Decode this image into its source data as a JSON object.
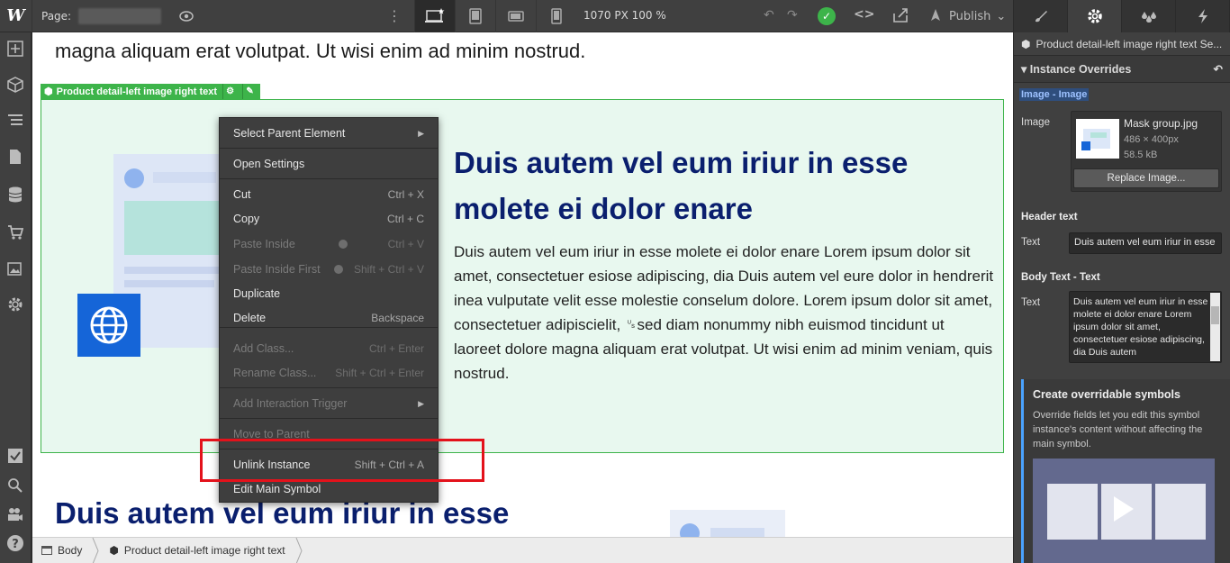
{
  "topbar": {
    "logo": "W",
    "page_label": "Page:",
    "dimensions": "1070 PX  100 %",
    "publish_label": "Publish"
  },
  "canvas": {
    "top_text": "magna aliquam erat volutpat. Ut wisi enim ad minim nostrud.",
    "symbol_tag": "Product detail-left image right text",
    "hero_heading": "Duis autem vel eum iriur in esse molete ei dolor enare",
    "hero_body": "Duis autem vel eum iriur in esse molete ei dolor enare Lorem ipsum dolor sit amet, consectetuer esiose adipiscing,  dia Duis autem vel eure dolor in hendrerit inea vulputate velit esse molestie conselum dolore. Lorem ipsum dolor sit amet, consectetuer adipiscielit, ␟sed diam nonummy nibh euismod tincidunt ut laoreet dolore magna aliquam erat volutpat. Ut wisi enim ad minim veniam, quis nostrud.",
    "bottom_heading": "Duis autem vel eum iriur in esse"
  },
  "context_menu": {
    "items": [
      {
        "label": "Select Parent Element",
        "shortcut": "",
        "submenu": true,
        "disabled": false
      },
      {
        "label": "Open Settings",
        "shortcut": "",
        "disabled": false
      },
      {
        "label": "Cut",
        "shortcut": "Ctrl + X",
        "disabled": false
      },
      {
        "label": "Copy",
        "shortcut": "Ctrl + C",
        "disabled": false
      },
      {
        "label": "Paste Inside",
        "shortcut": "Ctrl + V",
        "disabled": true
      },
      {
        "label": "Paste Inside First",
        "shortcut": "Shift + Ctrl + V",
        "disabled": true
      },
      {
        "label": "Duplicate",
        "shortcut": "",
        "disabled": false
      },
      {
        "label": "Delete",
        "shortcut": "Backspace",
        "disabled": false
      },
      {
        "label": "Add Class...",
        "shortcut": "Ctrl + Enter",
        "disabled": true
      },
      {
        "label": "Rename Class...",
        "shortcut": "Shift + Ctrl + Enter",
        "disabled": true
      },
      {
        "label": "Add Interaction Trigger",
        "shortcut": "",
        "submenu": true,
        "disabled": true
      },
      {
        "label": "Move to Parent",
        "shortcut": "",
        "disabled": true
      },
      {
        "label": "Unlink Instance",
        "shortcut": "Shift + Ctrl + A",
        "disabled": false
      },
      {
        "label": "Edit Main Symbol",
        "shortcut": "",
        "disabled": false
      }
    ]
  },
  "breadcrumbs": [
    "Body",
    "Product detail-left image right text"
  ],
  "right_panel": {
    "selected": "Product detail-left image right text Se...",
    "section_title": "Instance Overrides",
    "image_group": "Image - Image",
    "image_label": "Image",
    "image_name": "Mask group.jpg",
    "image_dims": "486 × 400px",
    "image_size": "58.5 kB",
    "replace_label": "Replace Image...",
    "header_group": "Header text",
    "header_label": "Text",
    "header_value": "Duis autem vel eum iriur in esse",
    "body_group": "Body Text - Text",
    "body_label": "Text",
    "body_value": "Duis autem vel eum iriur in esse molete ei dolor enare Lorem ipsum dolor sit amet, consectetuer esiose adipiscing,  dia Duis autem",
    "info_title": "Create overridable symbols",
    "info_text": "Override fields let you edit this symbol instance's content without affecting the main symbol."
  },
  "colors": {
    "accent_green": "#3db44a",
    "heading_navy": "#0a1f6e",
    "highlight_red": "#e3121b"
  }
}
